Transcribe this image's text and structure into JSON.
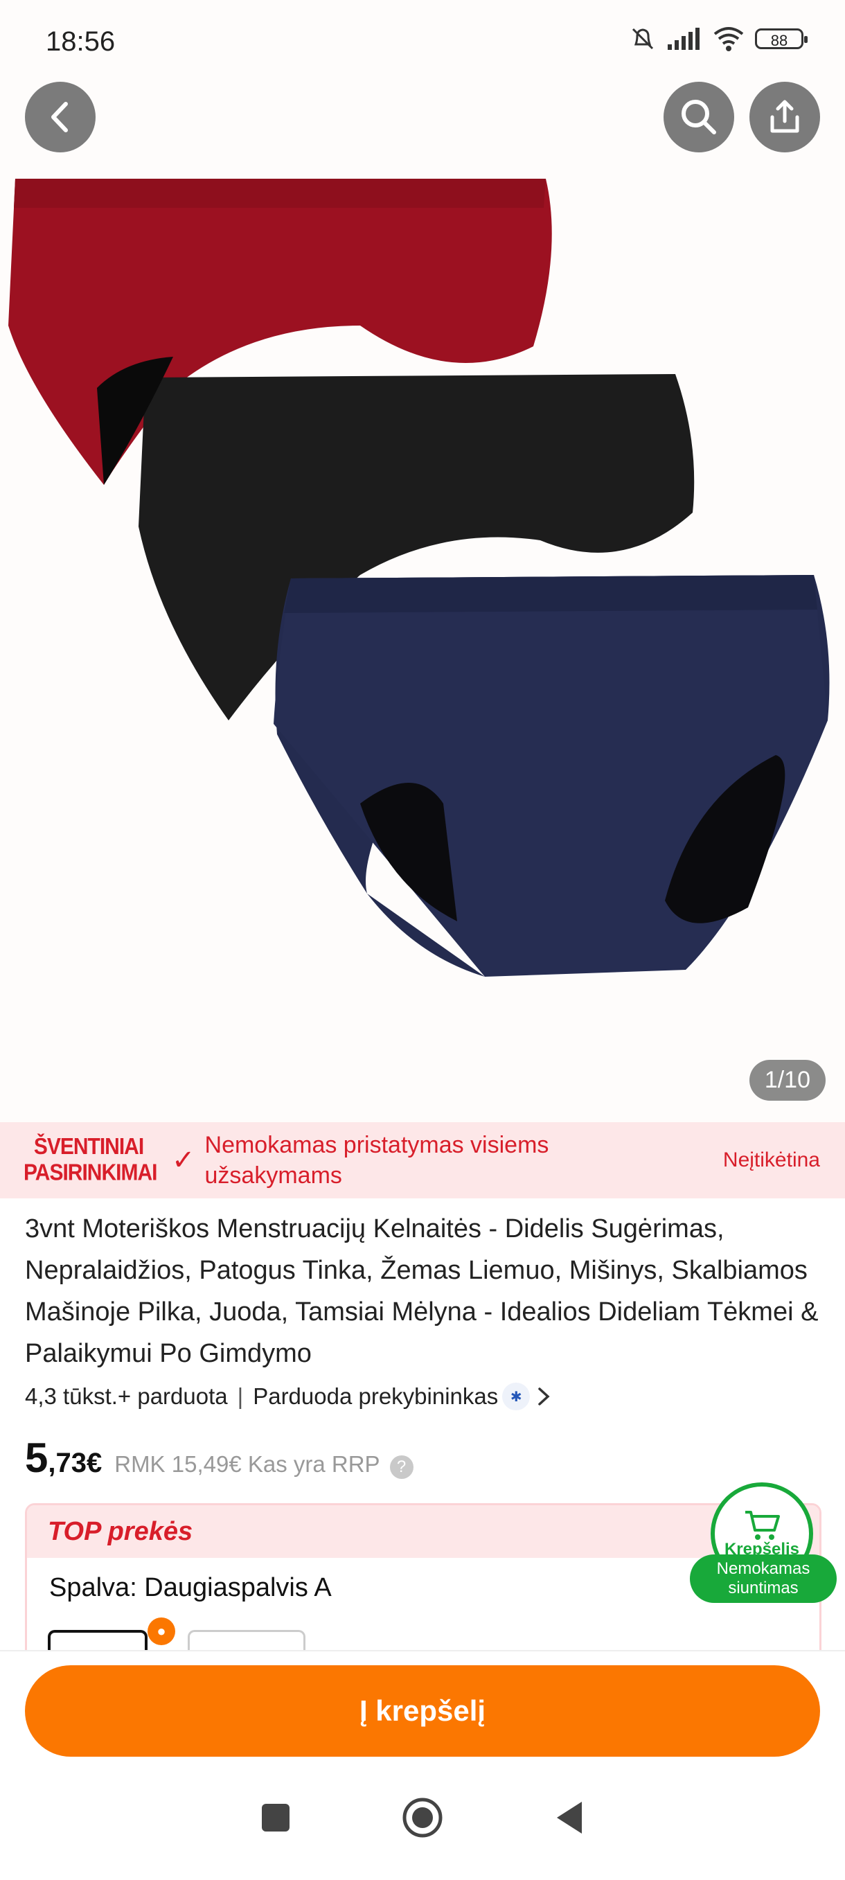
{
  "status_bar": {
    "time": "18:56",
    "battery": "88"
  },
  "gallery": {
    "counter": "1/10"
  },
  "promo": {
    "logo_line1": "ŠVENTINIAI",
    "logo_line2": "PASIRINKIMAI",
    "text": "Nemokamas pristatymas visiems užsakymams",
    "link": "Neįtikėtina"
  },
  "product": {
    "title": "3vnt Moteriškos Menstruacijų Kelnaitės - Didelis Sugėrimas, Nepralaidžios, Patogus Tinka, Žemas Liemuo, Mišinys, Skalbiamos Mašinoje Pilka, Juoda, Tamsiai Mėlyna - Idealios Dideliam Tėkmei & Palaikymui Po Gimdymo",
    "sold": "4,3 tūkst.+ parduota",
    "seller": "Parduoda prekybininkas",
    "price_int": "5",
    "price_dec": ",73€",
    "rrp": "RMK 15,49€ Kas yra RRP"
  },
  "top_section": {
    "header": "TOP prekės",
    "color_label": "Spalva: Daugiaspalvis A"
  },
  "cart_fab": {
    "label": "Krepšelis",
    "shipping": "Nemokamas siuntimas"
  },
  "bottom": {
    "add_to_cart": "Į krepšelį"
  }
}
